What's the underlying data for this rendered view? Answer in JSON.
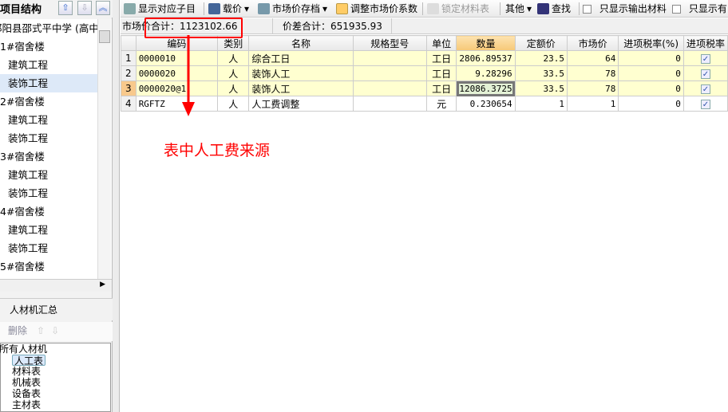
{
  "left_panel": {
    "title": "项目结构",
    "tree": [
      {
        "label": "邵阳县邵式平中学 (高中)",
        "level": 0
      },
      {
        "label": "1#宿舍楼",
        "level": 0
      },
      {
        "label": "建筑工程",
        "level": 1
      },
      {
        "label": "装饰工程",
        "level": 1,
        "selected": true
      },
      {
        "label": "2#宿舍楼",
        "level": 0
      },
      {
        "label": "建筑工程",
        "level": 1
      },
      {
        "label": "装饰工程",
        "level": 1
      },
      {
        "label": "3#宿舍楼",
        "level": 0
      },
      {
        "label": "建筑工程",
        "level": 1
      },
      {
        "label": "装饰工程",
        "level": 1
      },
      {
        "label": "4#宿舍楼",
        "level": 0
      },
      {
        "label": "建筑工程",
        "level": 1
      },
      {
        "label": "装饰工程",
        "level": 1
      },
      {
        "label": "5#宿舍楼",
        "level": 0
      }
    ],
    "bottom_tab": "人材机汇总",
    "delete_label": "删除",
    "category_tree": {
      "root": "所有人材机",
      "items": [
        "人工表",
        "材料表",
        "机械表",
        "设备表",
        "主材表"
      ],
      "selected": "人工表"
    }
  },
  "toolbar": {
    "show_child": "显示对应子目",
    "price": "载价",
    "save_price": "市场价存档",
    "adjust": "调整市场价系数",
    "lock": "锁定材料表",
    "other": "其他",
    "find": "查找",
    "only_output": "只显示输出材料",
    "only_some": "只显示有"
  },
  "summary": {
    "market_total": "市场价合计：1123102.66",
    "diff_total": "价差合计：651935.93"
  },
  "table": {
    "columns": [
      "",
      "编码",
      "类别",
      "名称",
      "规格型号",
      "单位",
      "数量",
      "定额价",
      "市场价",
      "进项税率(%)",
      "进项税率"
    ],
    "rows": [
      {
        "n": "1",
        "code": "0000010",
        "type": "人",
        "name": "综合工日",
        "spec": "",
        "unit": "工日",
        "qty": "2806.89537",
        "quota": "23.5",
        "market": "64",
        "tax": "0",
        "checked": true
      },
      {
        "n": "2",
        "code": "0000020",
        "type": "人",
        "name": "装饰人工",
        "spec": "",
        "unit": "工日",
        "qty": "9.28296",
        "quota": "33.5",
        "market": "78",
        "tax": "0",
        "checked": true
      },
      {
        "n": "3",
        "code": "0000020@1",
        "type": "人",
        "name": "装饰人工",
        "spec": "",
        "unit": "工日",
        "qty": "12086.3725",
        "quota": "33.5",
        "market": "78",
        "tax": "0",
        "checked": true
      },
      {
        "n": "4",
        "code": "RGFTZ",
        "type": "人",
        "name": "人工费调整",
        "spec": "",
        "unit": "元",
        "qty": "0.230654",
        "quota": "1",
        "market": "1",
        "tax": "0",
        "checked": true
      }
    ]
  },
  "annotation": {
    "text": "表中人工费来源",
    "color": "#ff0000"
  }
}
